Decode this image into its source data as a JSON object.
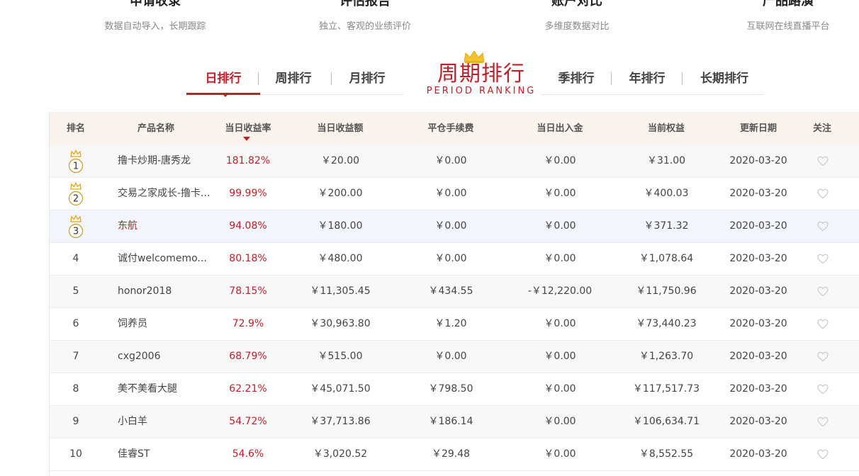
{
  "features": [
    {
      "title": "申请收录",
      "subtitle": "数据自动导入，长期跟踪"
    },
    {
      "title": "评估报告",
      "subtitle": "独立、客观的业绩评价"
    },
    {
      "title": "账户对比",
      "subtitle": "多维度数据对比"
    },
    {
      "title": "产品路演",
      "subtitle": "互联网在线直播平台"
    }
  ],
  "tabs": {
    "left": [
      "日排行",
      "周排行",
      "月排行"
    ],
    "right": [
      "季排行",
      "年排行",
      "长期排行"
    ],
    "active": "日排行"
  },
  "period_title": {
    "cn": "周期排行",
    "en": "PERIOD RANKING"
  },
  "table": {
    "headers": {
      "rank": "排名",
      "name": "产品名称",
      "rate": "当日收益率",
      "amount": "当日收益额",
      "fee": "平仓手续费",
      "flow": "当日出入金",
      "equity": "当前权益",
      "date": "更新日期",
      "follow": "关注"
    },
    "rows": [
      {
        "rank": "1",
        "name": "撸卡炒期-唐秀龙",
        "rate": "181.82%",
        "amount": "￥20.00",
        "fee": "￥0.00",
        "flow": "￥0.00",
        "equity": "￥31.00",
        "date": "2020-03-20"
      },
      {
        "rank": "2",
        "name": "交易之家成长-撸卡...",
        "rate": "99.99%",
        "amount": "￥200.00",
        "fee": "￥0.00",
        "flow": "￥0.00",
        "equity": "￥400.03",
        "date": "2020-03-20"
      },
      {
        "rank": "3",
        "name": "东航",
        "rate": "94.08%",
        "amount": "￥180.00",
        "fee": "￥0.00",
        "flow": "￥0.00",
        "equity": "￥371.32",
        "date": "2020-03-20"
      },
      {
        "rank": "4",
        "name": "诚付welcomemo...",
        "rate": "80.18%",
        "amount": "￥480.00",
        "fee": "￥0.00",
        "flow": "￥0.00",
        "equity": "￥1,078.64",
        "date": "2020-03-20"
      },
      {
        "rank": "5",
        "name": "honor2018",
        "rate": "78.15%",
        "amount": "￥11,305.45",
        "fee": "￥434.55",
        "flow": "-￥12,220.00",
        "equity": "￥11,750.96",
        "date": "2020-03-20"
      },
      {
        "rank": "6",
        "name": "饲养员",
        "rate": "72.9%",
        "amount": "￥30,963.80",
        "fee": "￥1.20",
        "flow": "￥0.00",
        "equity": "￥73,440.23",
        "date": "2020-03-20"
      },
      {
        "rank": "7",
        "name": "cxg2006",
        "rate": "68.79%",
        "amount": "￥515.00",
        "fee": "￥0.00",
        "flow": "￥0.00",
        "equity": "￥1,263.70",
        "date": "2020-03-20"
      },
      {
        "rank": "8",
        "name": "美不美看大腿",
        "rate": "62.21%",
        "amount": "￥45,071.50",
        "fee": "￥798.50",
        "flow": "￥0.00",
        "equity": "￥117,517.73",
        "date": "2020-03-20"
      },
      {
        "rank": "9",
        "name": "小白羊",
        "rate": "54.72%",
        "amount": "￥37,713.86",
        "fee": "￥186.14",
        "flow": "￥0.00",
        "equity": "￥106,634.71",
        "date": "2020-03-20"
      },
      {
        "rank": "10",
        "name": "佳睿ST",
        "rate": "54.6%",
        "amount": "￥3,020.52",
        "fee": "￥29.48",
        "flow": "￥0.00",
        "equity": "￥8,552.55",
        "date": "2020-03-20"
      }
    ]
  },
  "colors": {
    "accent": "#c0202a",
    "crown": "#e6b422",
    "header_bg": "#faf3ec"
  }
}
